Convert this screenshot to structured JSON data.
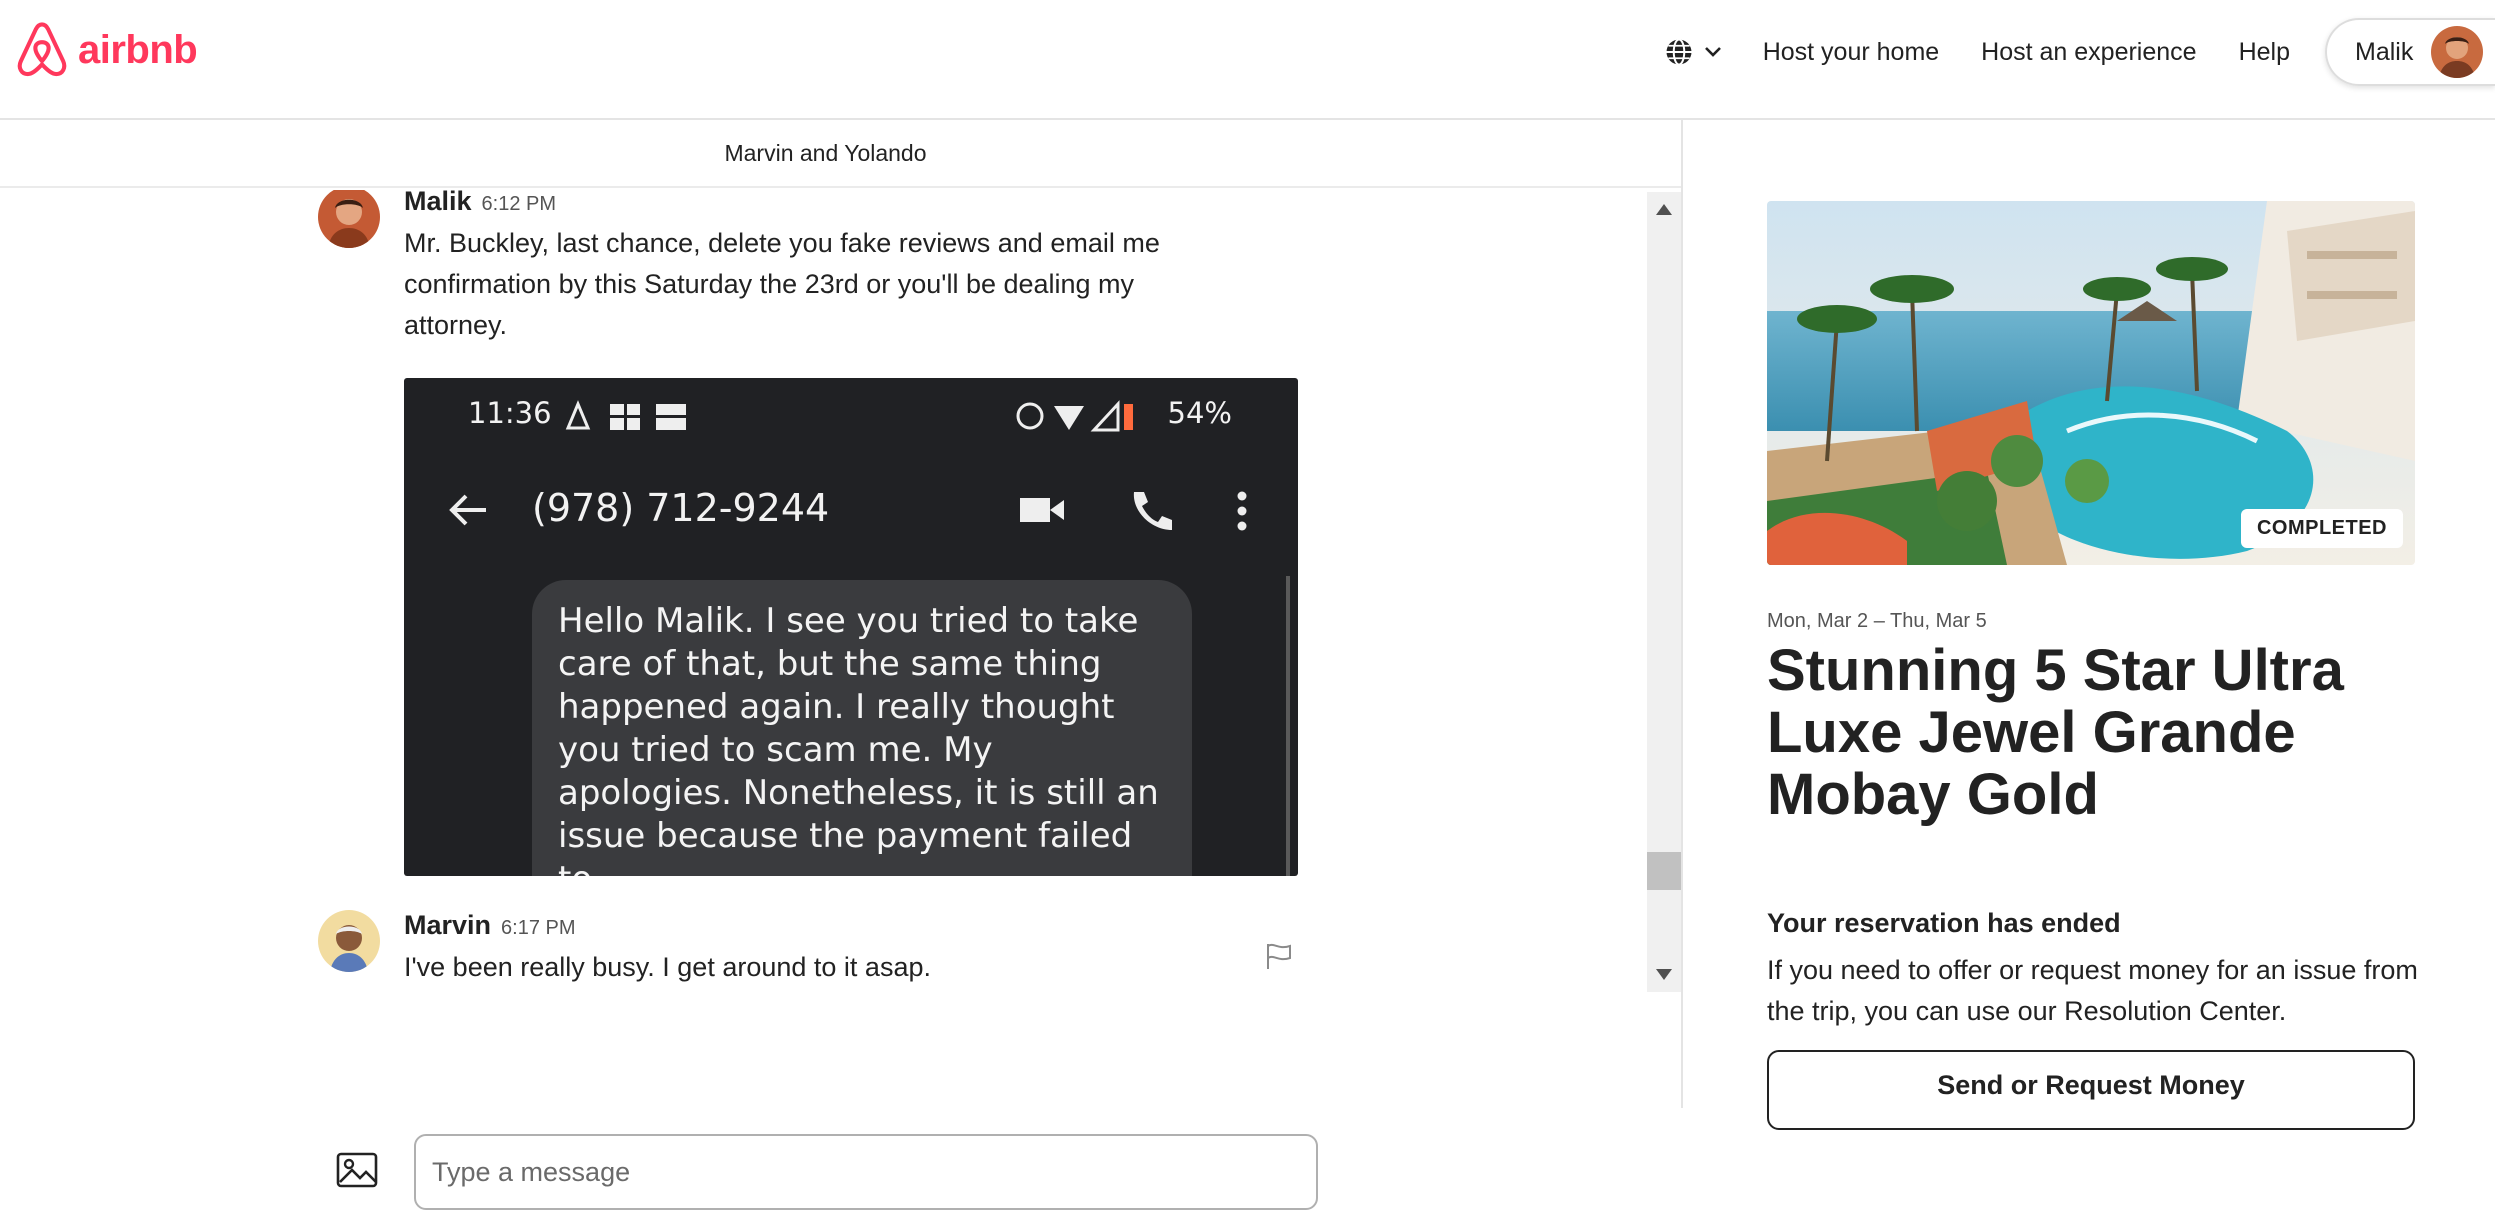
{
  "brand": {
    "name": "airbnb",
    "color": "#FF385C"
  },
  "header": {
    "language_icon": "globe-icon",
    "nav": [
      {
        "label": "Host your home"
      },
      {
        "label": "Host an experience"
      },
      {
        "label": "Help"
      }
    ],
    "user": {
      "name": "Malik"
    }
  },
  "conversation": {
    "title": "Marvin and Yolando",
    "messages": [
      {
        "sender": "Malik",
        "time": "6:12 PM",
        "text": "Mr. Buckley, last chance, delete you fake reviews and email me confirmation by this Saturday the 23rd or you'll be dealing my attorney.",
        "attachment": {
          "status_time": "11:36",
          "status_battery": "54%",
          "phone_number": "(978) 712-9244",
          "bubble_text": "Hello Malik. I see you tried to take care of that, but the same thing happened again. I really thought you tried to scam me. My apologies. Nonetheless, it is still an issue because the payment failed to"
        }
      },
      {
        "sender": "Marvin",
        "time": "6:17 PM",
        "text": "I've been really busy. I get around to it asap."
      }
    ],
    "composer": {
      "placeholder": "Type a message"
    }
  },
  "reservation": {
    "badge": "COMPLETED",
    "image_pages": 6,
    "active_image_page": 1,
    "dates": "Mon, Mar 2 – Thu, Mar 5",
    "title": "Stunning 5 Star Ultra Luxe Jewel Grande Mobay Gold",
    "ended_heading": "Your reservation has ended",
    "ended_text": "If you need to offer or request money for an issue from the trip, you can use our Resolution Center.",
    "money_button": "Send or Request Money"
  }
}
